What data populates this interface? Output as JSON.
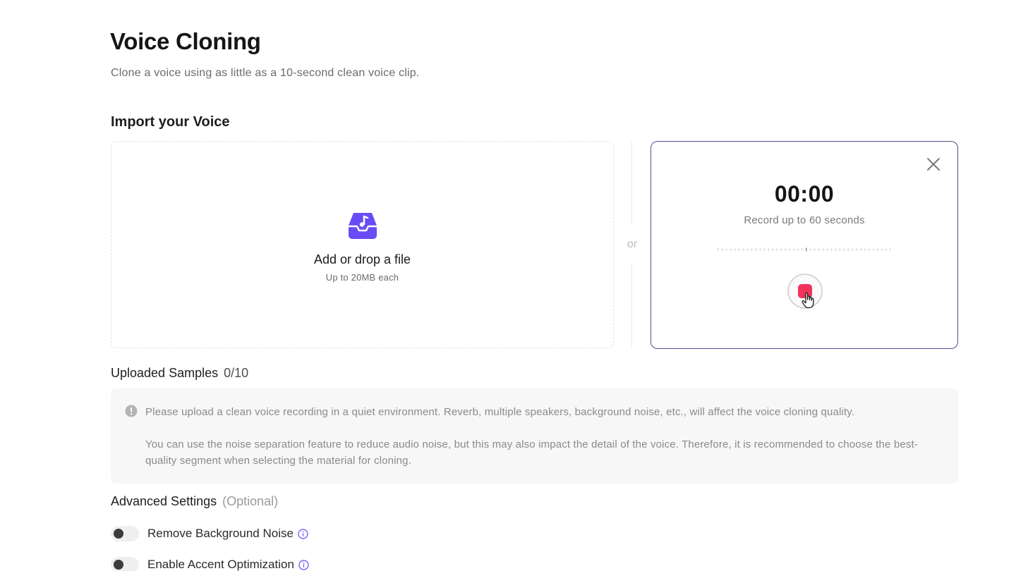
{
  "header": {
    "title": "Voice Cloning",
    "subtitle": "Clone a voice using as little as a 10-second clean voice clip."
  },
  "import": {
    "section_title": "Import your Voice",
    "upload_title": "Add or drop a file",
    "upload_sub": "Up to 20MB each",
    "separator": "or"
  },
  "recorder": {
    "timer": "00:00",
    "hint": "Record up to 60 seconds",
    "accent_color": "#4b4f8f",
    "stop_color": "#f1335c"
  },
  "samples": {
    "title": "Uploaded Samples",
    "count": "0/10"
  },
  "notice": {
    "paragraph_1": "Please upload a clean voice recording in a quiet environment. Reverb, multiple speakers, background noise, etc., will affect the voice cloning quality.",
    "paragraph_2": "You can use the noise separation feature to reduce audio noise, but this may also impact the detail of the voice. Therefore, it is recommended to choose the best-quality segment when selecting the material for cloning."
  },
  "advanced": {
    "title": "Advanced Settings",
    "optional": "(Optional)",
    "options": [
      {
        "label": "Remove Background Noise",
        "enabled": false
      },
      {
        "label": "Enable Accent Optimization",
        "enabled": false
      }
    ]
  },
  "brand_color": "#6a4cf5"
}
